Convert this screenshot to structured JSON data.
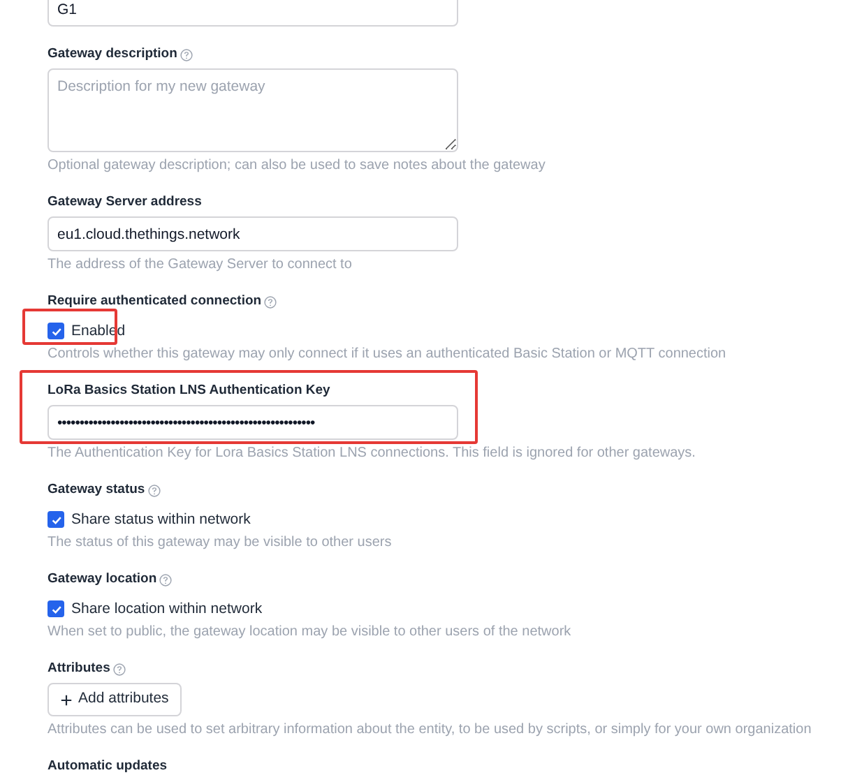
{
  "fields": [
    {
      "kind": "text",
      "value": "G1"
    },
    {
      "kind": "textarea",
      "label": "Gateway description",
      "info": true,
      "placeholder": "Description for my new gateway",
      "help": "Optional gateway description; can also be used to save notes about the gateway"
    },
    {
      "kind": "text",
      "label": "Gateway Server address",
      "value": "eu1.cloud.thethings.network",
      "help": "The address of the Gateway Server to connect to"
    },
    {
      "kind": "checkbox",
      "label": "Require authenticated connection",
      "info": true,
      "option": "Enabled",
      "checked": true,
      "highlighted": true,
      "help": "Controls whether this gateway may only connect if it uses an authenticated Basic Station or MQTT connection"
    },
    {
      "kind": "password",
      "label": "LoRa Basics Station LNS Authentication Key",
      "value": "••••••••••••••••••••••••••••••••••••••••••••••••••••••••••",
      "highlighted": true,
      "help": "The Authentication Key for Lora Basics Station LNS connections. This field is ignored for other gateways."
    },
    {
      "kind": "checkbox",
      "label": "Gateway status",
      "info": true,
      "option": "Share status within network",
      "checked": true,
      "help": "The status of this gateway may be visible to other users"
    },
    {
      "kind": "checkbox",
      "label": "Gateway location",
      "info": true,
      "option": "Share location within network",
      "checked": true,
      "help": "When set to public, the gateway location may be visible to other users of the network"
    },
    {
      "kind": "button",
      "label": "Attributes",
      "info": true,
      "button": "Add attributes",
      "help": "Attributes can be used to set arbitrary information about the entity, to be used by scripts, or simply for your own organization"
    },
    {
      "kind": "none",
      "label": "Automatic updates"
    }
  ]
}
